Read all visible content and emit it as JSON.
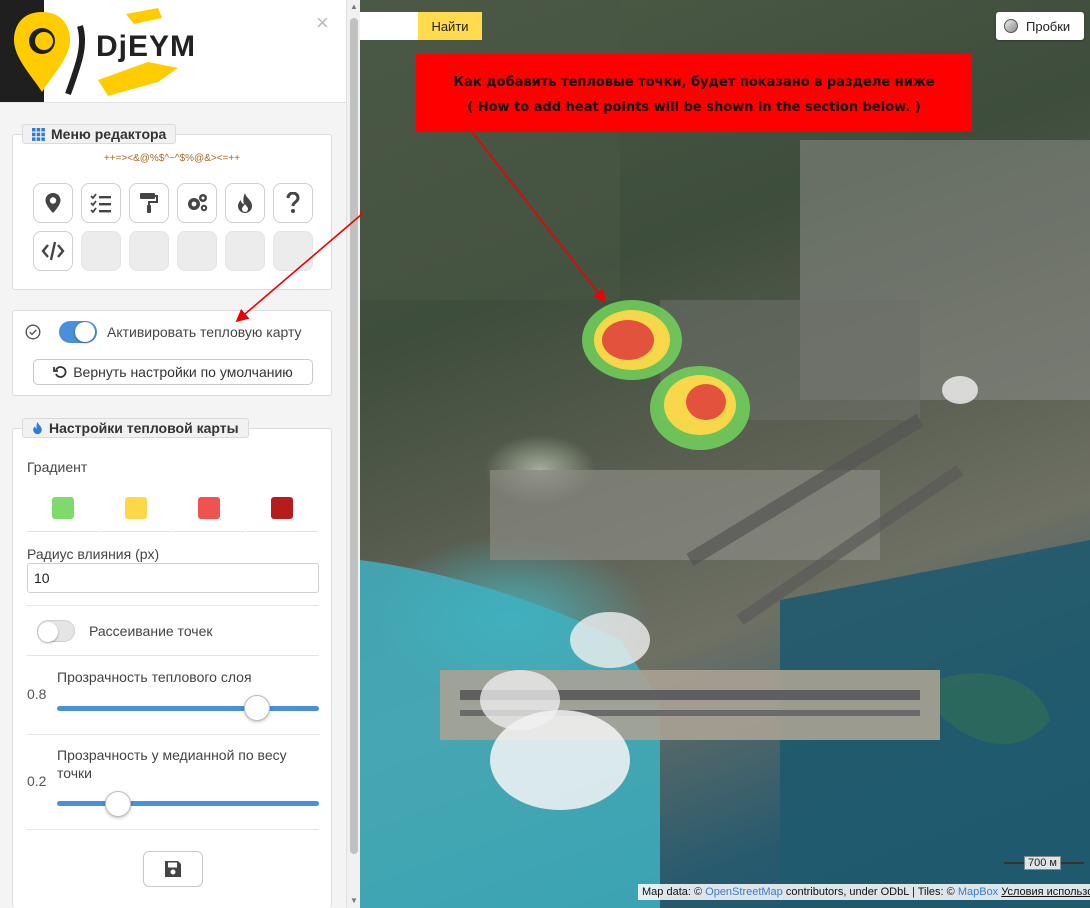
{
  "sidebar": {
    "logo_text": "DjEYM",
    "close_icon": "×",
    "editor_menu": {
      "title": "Меню редактора",
      "symbols": "++=><&@%$^~^$%@&><=++",
      "tools_row1": [
        "marker-icon",
        "list-icon",
        "paint-roller-icon",
        "gears-icon",
        "fire-icon",
        "question-icon"
      ],
      "tools_row2": [
        "code-icon",
        "",
        "",
        "",
        "",
        ""
      ]
    },
    "heatmap_activation": {
      "toggle_label": "Активировать тепловую карту",
      "toggle_on": true,
      "reset_button": "Вернуть настройки по умолчанию"
    },
    "heatmap_settings": {
      "title": "Настройки тепловой карты",
      "gradient_label": "Градиент",
      "gradient_colors": [
        "#7edb6b",
        "#ffd84a",
        "#ef5350",
        "#b71c1c"
      ],
      "radius_label": "Радиус влияния (px)",
      "radius_value": "10",
      "dissipate_label": "Рассеивание точек",
      "dissipate_on": false,
      "opacity_label": "Прозрачность теплового слоя",
      "opacity_value": "0.8",
      "median_label": "Прозрачность у медианной по весу точки",
      "median_value": "0.2",
      "save_icon": "save-icon"
    }
  },
  "map": {
    "search_button": "Найти",
    "traffic_button": "Пробки",
    "annotation_line1": "Как добавить тепловые точки,  будет показано в разделе ниже",
    "annotation_line2": "( How to add heat points will be shown in the section below. )",
    "scale": "700 м",
    "attribution": {
      "prefix": "Map data: © ",
      "osm": "OpenStreetMap",
      "middle": " contributors, under ODbL | Tiles: © ",
      "mapbox": "MapBox",
      "terms": "Условия использования"
    },
    "colors": {
      "annotation_bg": "#ff0000",
      "search_button_bg": "#ffdb4d",
      "accent": "#4a8fd9"
    }
  }
}
